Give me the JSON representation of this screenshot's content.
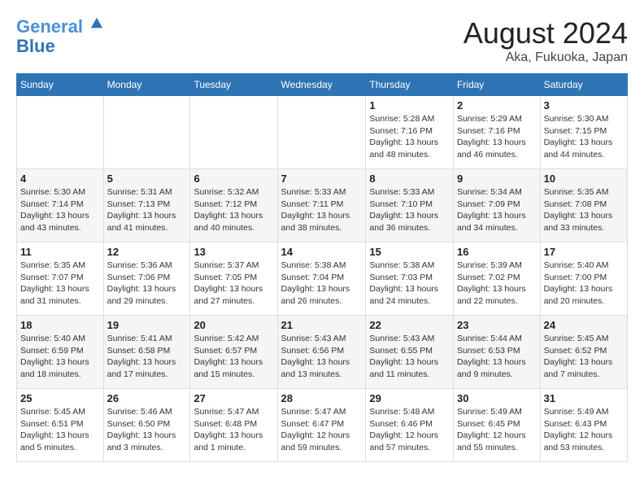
{
  "header": {
    "logo_line1": "General",
    "logo_line2": "Blue",
    "title": "August 2024",
    "subtitle": "Aka, Fukuoka, Japan"
  },
  "weekdays": [
    "Sunday",
    "Monday",
    "Tuesday",
    "Wednesday",
    "Thursday",
    "Friday",
    "Saturday"
  ],
  "weeks": [
    [
      {
        "day": "",
        "info": ""
      },
      {
        "day": "",
        "info": ""
      },
      {
        "day": "",
        "info": ""
      },
      {
        "day": "",
        "info": ""
      },
      {
        "day": "1",
        "info": "Sunrise: 5:28 AM\nSunset: 7:16 PM\nDaylight: 13 hours\nand 48 minutes."
      },
      {
        "day": "2",
        "info": "Sunrise: 5:29 AM\nSunset: 7:16 PM\nDaylight: 13 hours\nand 46 minutes."
      },
      {
        "day": "3",
        "info": "Sunrise: 5:30 AM\nSunset: 7:15 PM\nDaylight: 13 hours\nand 44 minutes."
      }
    ],
    [
      {
        "day": "4",
        "info": "Sunrise: 5:30 AM\nSunset: 7:14 PM\nDaylight: 13 hours\nand 43 minutes."
      },
      {
        "day": "5",
        "info": "Sunrise: 5:31 AM\nSunset: 7:13 PM\nDaylight: 13 hours\nand 41 minutes."
      },
      {
        "day": "6",
        "info": "Sunrise: 5:32 AM\nSunset: 7:12 PM\nDaylight: 13 hours\nand 40 minutes."
      },
      {
        "day": "7",
        "info": "Sunrise: 5:33 AM\nSunset: 7:11 PM\nDaylight: 13 hours\nand 38 minutes."
      },
      {
        "day": "8",
        "info": "Sunrise: 5:33 AM\nSunset: 7:10 PM\nDaylight: 13 hours\nand 36 minutes."
      },
      {
        "day": "9",
        "info": "Sunrise: 5:34 AM\nSunset: 7:09 PM\nDaylight: 13 hours\nand 34 minutes."
      },
      {
        "day": "10",
        "info": "Sunrise: 5:35 AM\nSunset: 7:08 PM\nDaylight: 13 hours\nand 33 minutes."
      }
    ],
    [
      {
        "day": "11",
        "info": "Sunrise: 5:35 AM\nSunset: 7:07 PM\nDaylight: 13 hours\nand 31 minutes."
      },
      {
        "day": "12",
        "info": "Sunrise: 5:36 AM\nSunset: 7:06 PM\nDaylight: 13 hours\nand 29 minutes."
      },
      {
        "day": "13",
        "info": "Sunrise: 5:37 AM\nSunset: 7:05 PM\nDaylight: 13 hours\nand 27 minutes."
      },
      {
        "day": "14",
        "info": "Sunrise: 5:38 AM\nSunset: 7:04 PM\nDaylight: 13 hours\nand 26 minutes."
      },
      {
        "day": "15",
        "info": "Sunrise: 5:38 AM\nSunset: 7:03 PM\nDaylight: 13 hours\nand 24 minutes."
      },
      {
        "day": "16",
        "info": "Sunrise: 5:39 AM\nSunset: 7:02 PM\nDaylight: 13 hours\nand 22 minutes."
      },
      {
        "day": "17",
        "info": "Sunrise: 5:40 AM\nSunset: 7:00 PM\nDaylight: 13 hours\nand 20 minutes."
      }
    ],
    [
      {
        "day": "18",
        "info": "Sunrise: 5:40 AM\nSunset: 6:59 PM\nDaylight: 13 hours\nand 18 minutes."
      },
      {
        "day": "19",
        "info": "Sunrise: 5:41 AM\nSunset: 6:58 PM\nDaylight: 13 hours\nand 17 minutes."
      },
      {
        "day": "20",
        "info": "Sunrise: 5:42 AM\nSunset: 6:57 PM\nDaylight: 13 hours\nand 15 minutes."
      },
      {
        "day": "21",
        "info": "Sunrise: 5:43 AM\nSunset: 6:56 PM\nDaylight: 13 hours\nand 13 minutes."
      },
      {
        "day": "22",
        "info": "Sunrise: 5:43 AM\nSunset: 6:55 PM\nDaylight: 13 hours\nand 11 minutes."
      },
      {
        "day": "23",
        "info": "Sunrise: 5:44 AM\nSunset: 6:53 PM\nDaylight: 13 hours\nand 9 minutes."
      },
      {
        "day": "24",
        "info": "Sunrise: 5:45 AM\nSunset: 6:52 PM\nDaylight: 13 hours\nand 7 minutes."
      }
    ],
    [
      {
        "day": "25",
        "info": "Sunrise: 5:45 AM\nSunset: 6:51 PM\nDaylight: 13 hours\nand 5 minutes."
      },
      {
        "day": "26",
        "info": "Sunrise: 5:46 AM\nSunset: 6:50 PM\nDaylight: 13 hours\nand 3 minutes."
      },
      {
        "day": "27",
        "info": "Sunrise: 5:47 AM\nSunset: 6:48 PM\nDaylight: 13 hours\nand 1 minute."
      },
      {
        "day": "28",
        "info": "Sunrise: 5:47 AM\nSunset: 6:47 PM\nDaylight: 12 hours\nand 59 minutes."
      },
      {
        "day": "29",
        "info": "Sunrise: 5:48 AM\nSunset: 6:46 PM\nDaylight: 12 hours\nand 57 minutes."
      },
      {
        "day": "30",
        "info": "Sunrise: 5:49 AM\nSunset: 6:45 PM\nDaylight: 12 hours\nand 55 minutes."
      },
      {
        "day": "31",
        "info": "Sunrise: 5:49 AM\nSunset: 6:43 PM\nDaylight: 12 hours\nand 53 minutes."
      }
    ]
  ]
}
